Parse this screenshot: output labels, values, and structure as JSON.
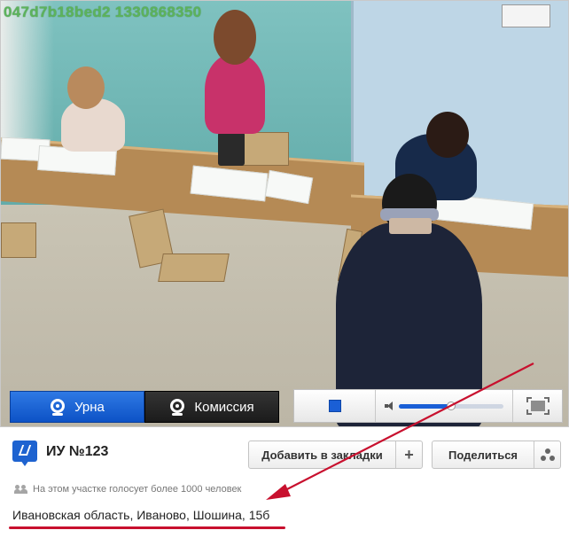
{
  "video": {
    "camera_id": "047d7b18bed2 1330868350",
    "door_sign": "",
    "tabs": [
      {
        "label": "Урна",
        "icon": "webcam-icon",
        "active": true
      },
      {
        "label": "Комиссия",
        "icon": "webcam-icon",
        "active": false
      }
    ],
    "player": {
      "stop_icon": "stop-icon",
      "volume_icon": "speaker-icon",
      "volume_level": 0.5,
      "fullscreen_icon": "fullscreen-icon"
    }
  },
  "station": {
    "icon": "ballot-box-icon",
    "title": "ИУ №123",
    "bookmark_label": "Добавить в закладки",
    "bookmark_icon": "plus-icon",
    "share_label": "Поделиться",
    "share_icon": "share-icon",
    "voters_icon": "people-icon",
    "voters_text": "На этом участке голосует более 1000 человек",
    "address": "Ивановская область, Иваново, Шошина, 15б"
  },
  "colors": {
    "accent_blue": "#1e63d0",
    "annotation_red": "#c8102e",
    "camera_id_green": "#5cb35c"
  }
}
